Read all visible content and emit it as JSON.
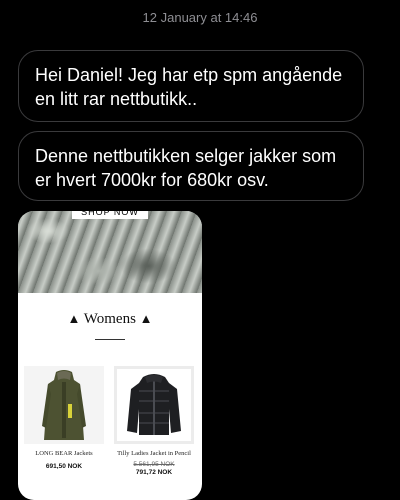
{
  "timestamp": "12 January at 14:46",
  "messages": [
    "Hei Daniel! Jeg har etp spm angående en litt rar nettbutikk..",
    "Denne nettbutikken selger jakker som er hvert 7000kr for 680kr osv."
  ],
  "shared_image": {
    "hero_button": "SHOP NOW",
    "section_title": "Womens",
    "products": [
      {
        "name": "LONG BEAR Jackets",
        "price": "691,50 NOK"
      },
      {
        "name": "Tilly Ladies Jacket in Pencil",
        "old_price": "5.561,95 NOK",
        "price": "791,72 NOK"
      }
    ]
  },
  "colors": {
    "background": "#000000",
    "bubble_border": "#3a3a3c",
    "timestamp": "#8e8e93"
  }
}
